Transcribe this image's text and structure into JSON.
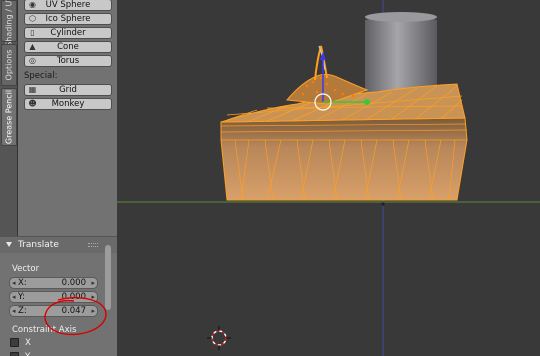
{
  "tabs": [
    {
      "label": "Shading / UV"
    },
    {
      "label": "Options"
    },
    {
      "label": "Grease Pencil"
    }
  ],
  "toolshelf": {
    "add_items": [
      {
        "label": "UV Sphere",
        "icon": "uv-sphere-icon"
      },
      {
        "label": "Ico Sphere",
        "icon": "ico-sphere-icon"
      },
      {
        "label": "Cylinder",
        "icon": "cylinder-icon"
      },
      {
        "label": "Cone",
        "icon": "cone-icon"
      },
      {
        "label": "Torus",
        "icon": "torus-icon"
      }
    ],
    "special_label": "Special:",
    "special_items": [
      {
        "label": "Grid",
        "icon": "grid-icon"
      },
      {
        "label": "Monkey",
        "icon": "monkey-icon"
      }
    ]
  },
  "operator": {
    "title": "Translate",
    "vector_label": "Vector",
    "fields": [
      {
        "label": "X:",
        "value": "0.000"
      },
      {
        "label": "Y:",
        "value": "0.000"
      },
      {
        "label": "Z:",
        "value": "0.047"
      }
    ],
    "constraint_label": "Constraint Axis",
    "checkboxes": [
      {
        "label": "X"
      },
      {
        "label": "Y"
      }
    ]
  },
  "colors": {
    "panel": "#727272",
    "viewport": "#393939",
    "selection": "#ff9b1a",
    "annotation": "#d80000",
    "x_axis": "#70a338",
    "z_axis": "#5050d0"
  }
}
